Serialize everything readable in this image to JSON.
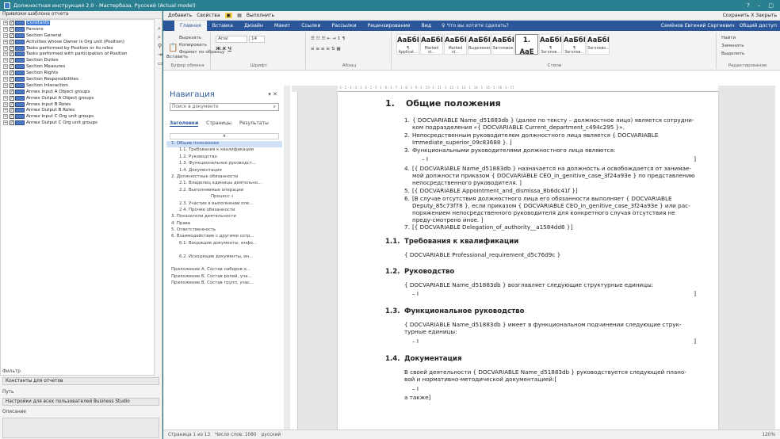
{
  "window": {
    "title": "Должностная инструкция 2.0 - Мастербаза, Русский (Actual model)"
  },
  "left": {
    "header": "Привязки шаблона отчета",
    "tree": [
      {
        "label": "Constants",
        "selected": true
      },
      {
        "label": "Persons"
      },
      {
        "label": "Section General"
      },
      {
        "label": "Activities whose Owner is Org unit (Position)"
      },
      {
        "label": "Tasks performed by Position or its roles"
      },
      {
        "label": "Tasks performed with participation of Position"
      },
      {
        "label": "Section Duties"
      },
      {
        "label": "Section Measures"
      },
      {
        "label": "Section Rights"
      },
      {
        "label": "Section Responsibilities"
      },
      {
        "label": "Section Interaction"
      },
      {
        "label": "Annex Input A Object groups"
      },
      {
        "label": "Annex Output A Object groups"
      },
      {
        "label": "Annex Input B Roles"
      },
      {
        "label": "Annex Output B Roles"
      },
      {
        "label": "Annex Input C Org unit groups"
      },
      {
        "label": "Annex Output C Org unit groups"
      }
    ],
    "filter_label": "Фильтр",
    "filter_value": "Константы для отчетов",
    "path_label": "Путь",
    "path_value": "Настройки для всех пользователей Business Studio",
    "description_label": "Описание"
  },
  "word": {
    "qa": {
      "add": "Добавить",
      "props": "Свойства",
      "run": "Выполнить",
      "save_close": "Сохранить  Х Закрыть"
    },
    "tabs": [
      "Главная",
      "Вставка",
      "Дизайн",
      "Макет",
      "Ссылки",
      "Рассылки",
      "Рецензирование",
      "Вид"
    ],
    "tellme": "Что вы хотите сделать?",
    "user": "Семёнов Евгений Сергеевич",
    "share": "Общий доступ",
    "ribbon": {
      "clipboard": {
        "label": "Буфер обмена",
        "paste": "Вставить",
        "cut": "Вырезать",
        "copy": "Копировать",
        "format": "Формат по образцу"
      },
      "font": {
        "label": "Шрифт",
        "name": "Arial",
        "size": "14"
      },
      "paragraph": {
        "label": "Абзац"
      },
      "styles": {
        "label": "Стили",
        "items": [
          {
            "sample": "AaБбЕ",
            "name": "¶ Applicat..."
          },
          {
            "sample": "AaБбЕ",
            "name": "Marked st..."
          },
          {
            "sample": "AaБбЕ",
            "name": "Marked st..."
          },
          {
            "sample": "AaБбГг",
            "name": "Выделение"
          },
          {
            "sample": "AaБбI",
            "name": "Заголовок"
          },
          {
            "sample": "1. AaE",
            "name": "¶ Заголов..."
          },
          {
            "sample": "AaБбВ",
            "name": "¶ Заголов..."
          },
          {
            "sample": "AaБбВ",
            "name": "¶ Заголов..."
          },
          {
            "sample": "AaБбВ",
            "name": "Заголово..."
          }
        ]
      },
      "editing": {
        "label": "Редактирование",
        "find": "Найти",
        "replace": "Заменить",
        "select": "Выделить"
      }
    },
    "nav": {
      "title": "Навигация",
      "search_placeholder": "Поиск в документе",
      "tabs": [
        "Заголовки",
        "Страницы",
        "Результаты"
      ],
      "items": [
        {
          "text": "1. Общие положения",
          "level": 0,
          "sel": true
        },
        {
          "text": "1.1. Требования к квалификации",
          "level": 1
        },
        {
          "text": "1.2. Руководство",
          "level": 1
        },
        {
          "text": "1.3. Функциональное руководст...",
          "level": 1
        },
        {
          "text": "1.4. Документация",
          "level": 1
        },
        {
          "text": "2. Должностные обязанности",
          "level": 0
        },
        {
          "text": "2.1. Владелец единицы деятельно...",
          "level": 1
        },
        {
          "text": "2.2. Выполняемые операции",
          "level": 1
        },
        {
          "text": "Процесс »",
          "level": 2
        },
        {
          "text": "2.3. Участие в выполнении опе...",
          "level": 1
        },
        {
          "text": "2.4. Прочие обязанности",
          "level": 1
        },
        {
          "text": "3. Показатели деятельности",
          "level": 0
        },
        {
          "text": "4. Права",
          "level": 0
        },
        {
          "text": "5. Ответственность",
          "level": 0
        },
        {
          "text": "6. Взаимодействие с другими сотр...",
          "level": 0
        },
        {
          "text": "6.1. Входящие документы, инфо...",
          "level": 1
        },
        {
          "text": "",
          "level": 1
        },
        {
          "text": "6.2. Исходящие документы, ин...",
          "level": 1
        },
        {
          "text": "",
          "level": 1
        },
        {
          "text": "Приложение А. Состав наборов о...",
          "level": 0
        },
        {
          "text": "Приложение Б. Состав ролей, уча...",
          "level": 0
        },
        {
          "text": "Приложение В. Состав групп, учас...",
          "level": 0
        }
      ]
    },
    "doc": {
      "h1_num": "1.",
      "h1_text": "Общие положения",
      "p1": "{ DOCVARIABLE Name_d51883db } (далее по тексту – должностное лицо) является сотрудни-ком подразделения «{ DOCVARIABLE Current_department_c494c295 }».",
      "p2": "Непосредственным руководителем должностного лица является { DOCVARIABLE Immediate_superior_09c83688 }. ]",
      "p3": "Функциональными руководителями должностного лица являются:",
      "p4": "[{ DOCVARIABLE Name_d51883db } назначается на должность и освобождается от занимае-мой должности приказом { DOCVARIABLE CEO_in_genitive_case_3f24a93e } по представлению непосредственного руководителя. ]",
      "p5": "[{ DOCVARIABLE Appointment_and_dismissa_8b6dc41f }]",
      "p6": "[В случае отсутствия должностного лица его обязанности выполняет { DOCVARIABLE Deputy_85c73f78 }, если приказом { DOCVARIABLE CEO_in_genitive_case_3f24a93e } или рас-поряжением непосредственного руководителя для конкретного случая отсутствия не преду-смотрено иное. ]",
      "p7": "[{ DOCVARIABLE Delegation_of_authority__a1584dd6 }]",
      "s11_num": "1.1.",
      "s11_text": "Требования к квалификации",
      "s11_p": "{ DOCVARIABLE Professional_requirement_d5c76d9c }",
      "s12_num": "1.2.",
      "s12_text": "Руководство",
      "s12_p": "{ DOCVARIABLE Name_d51883db } возглавляет следующие структурные единицы:",
      "s13_num": "1.3.",
      "s13_text": "Функциональное руководство",
      "s13_p": "{ DOCVARIABLE Name_d51883db } имеет в функциональном подчинении следующие струк-турные единицы:",
      "s14_num": "1.4.",
      "s14_text": "Документация",
      "s14_p": "В своей деятельности { DOCVARIABLE Name_d51883db } руководствуется следующей плано-вой и нормативно-методической документацией:[",
      "s14_tail": "а также]",
      "dash": "– ",
      "bracket": "]"
    },
    "status": {
      "page": "Страница 1 из 13",
      "words": "Число слов: 1080",
      "lang": "русский",
      "zoom": "120%"
    }
  }
}
